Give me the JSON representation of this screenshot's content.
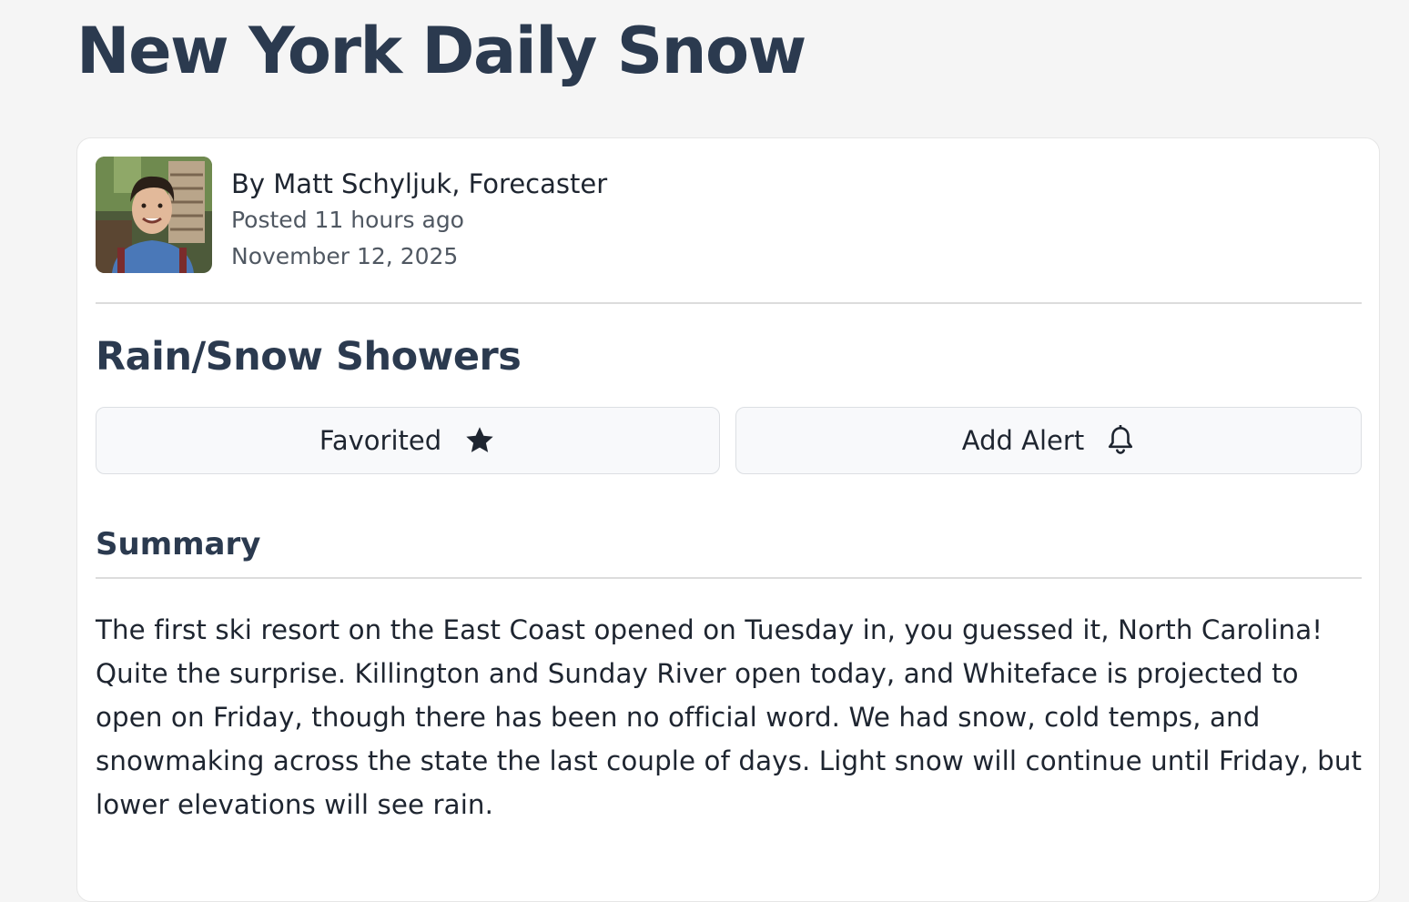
{
  "page": {
    "title": "New York Daily Snow"
  },
  "author": {
    "byline": "By Matt Schyljuk, Forecaster",
    "posted": "Posted 11 hours ago",
    "date": "November 12, 2025",
    "avatar_icon": "author-photo"
  },
  "forecast": {
    "title": "Rain/Snow Showers"
  },
  "actions": {
    "favorite_label": "Favorited",
    "favorite_icon": "star-filled-icon",
    "alert_label": "Add Alert",
    "alert_icon": "bell-icon"
  },
  "summary": {
    "heading": "Summary",
    "body": "The first ski resort on the East Coast opened on Tuesday in, you guessed it, North Carolina! Quite the surprise. Killington and Sunday River open today, and Whiteface is projected to open on Friday, though there has been no official word. We had snow, cold temps, and snowmaking across the state the last couple of days. Light snow will continue until Friday, but lower elevations will see rain."
  },
  "colors": {
    "heading": "#2b3a4f",
    "background": "#f5f5f5",
    "card": "#ffffff",
    "button_bg": "#f8f9fb"
  }
}
